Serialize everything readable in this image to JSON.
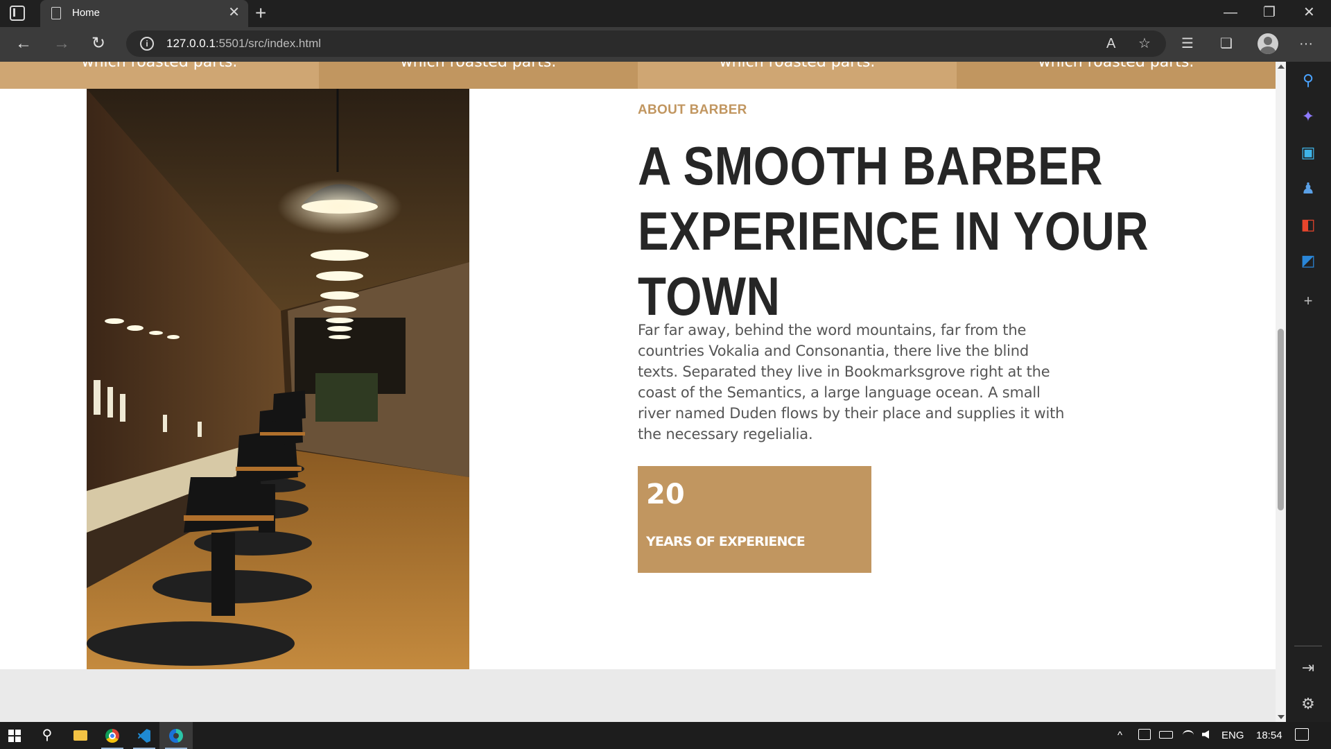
{
  "browser": {
    "tab_title": "Home",
    "url_host": "127.0.0.1",
    "url_rest": ":5501/src/index.html",
    "close_glyph": "✕",
    "new_tab_glyph": "+",
    "minimize_glyph": "—",
    "restore_glyph": "❐",
    "window_close_glyph": "✕",
    "back_glyph": "←",
    "forward_glyph": "→",
    "reload_glyph": "↻",
    "info_glyph": "i",
    "read_aloud_glyph": "A",
    "fav_glyph": "☆",
    "favorites_glyph": "☰",
    "collections_glyph": "❏",
    "more_glyph": "···"
  },
  "page": {
    "services_strip": {
      "items": [
        {
          "text": "which roasted parts."
        },
        {
          "text": "which roasted parts."
        },
        {
          "text": "which roasted parts."
        },
        {
          "text": "which roasted parts."
        }
      ]
    },
    "about": {
      "eyebrow": "ABOUT BARBER",
      "heading_line1": "A SMOOTH BARBER",
      "heading_line2": "EXPERIENCE IN YOUR TOWN",
      "paragraph": "Far far away, behind the word mountains, far from the countries Vokalia and Consonantia, there live the blind texts. Separated they live in Bookmarksgrove right at the coast of the Semantics, a large language ocean. A small river named Duden flows by their place and supplies it with the necessary regelialia.",
      "stat_number": "20",
      "stat_label": "YEARS OF EXPERIENCE"
    }
  },
  "sidebar": {
    "search_glyph": "⚲",
    "copilot_glyph": "✦",
    "tools_glyph": "▣",
    "games_glyph": "♟",
    "office_glyph": "◧",
    "outlook_glyph": "◩",
    "add_glyph": "+",
    "hide_glyph": "⇥",
    "settings_glyph": "⚙"
  },
  "taskbar": {
    "search_glyph": "⚲",
    "tray_chevron": "^",
    "language": "ENG",
    "time": "18:54"
  },
  "colors": {
    "accent": "#c19660",
    "services_tan": "#cfa673",
    "heading": "#262626",
    "body_text": "#555555"
  }
}
